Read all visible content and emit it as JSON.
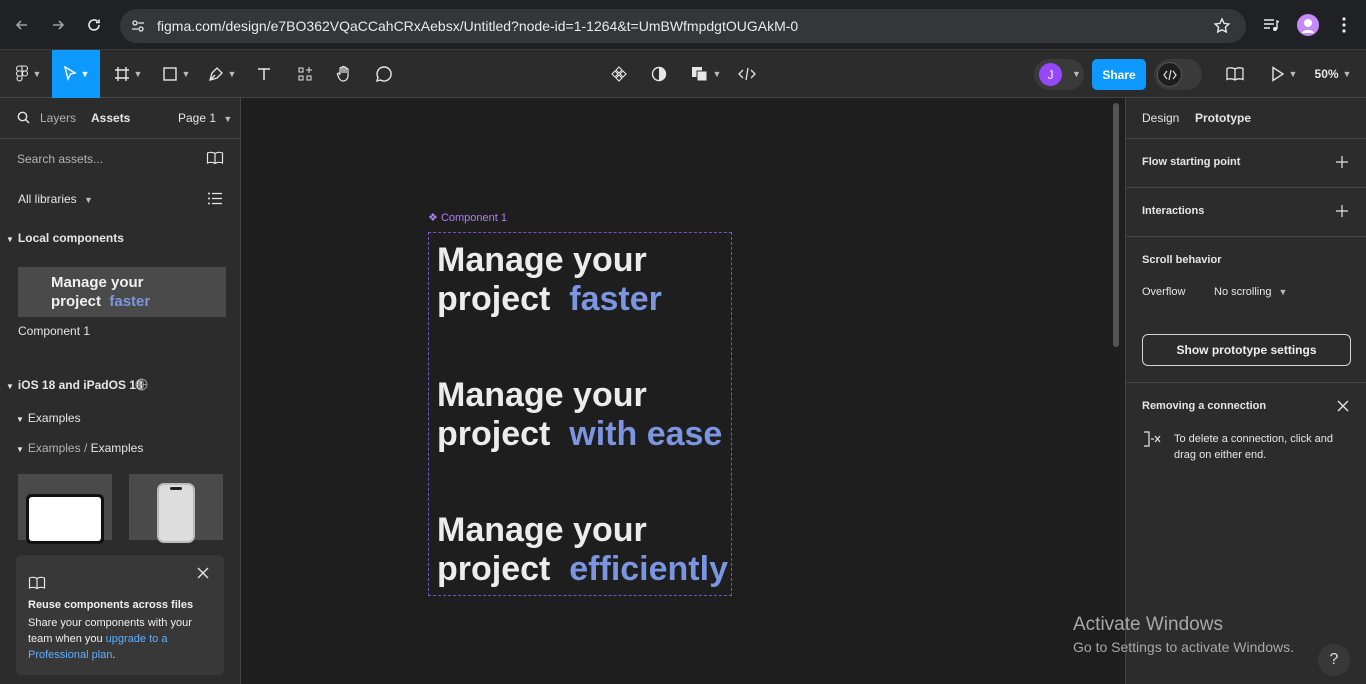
{
  "browser": {
    "url": "figma.com/design/e7BO362VQaCCahCRxAebsx/Untitled?node-id=1-1264&t=UmBWfmpdgtOUGAkM-0"
  },
  "toolbar": {
    "share_label": "Share",
    "zoom": "50%",
    "user_initial": "J",
    "accent_color": "#0d99ff"
  },
  "left_panel": {
    "tabs": [
      "Layers",
      "Assets"
    ],
    "active_tab": "Assets",
    "page_label": "Page 1",
    "search_placeholder": "Search assets...",
    "library_filter": "All libraries",
    "local_components_title": "Local components",
    "local_component": {
      "name": "Component 1",
      "thumb_line1": "Manage your",
      "thumb_line2": "project",
      "thumb_highlight": "faster"
    },
    "library": {
      "title": "iOS 18 and iPadOS 18",
      "group": "Examples",
      "subgroup_parent": "Examples /",
      "subgroup": "Examples"
    },
    "promo": {
      "title": "Reuse components across files",
      "body": "Share your components with your team when you",
      "link": "upgrade to a Professional plan",
      "end": "."
    }
  },
  "canvas": {
    "component_label": "Component 1",
    "variants": [
      {
        "line1": "Manage your",
        "line2": "project",
        "highlight": "faster"
      },
      {
        "line1": "Manage your",
        "line2": "project",
        "highlight": "with ease"
      },
      {
        "line1": "Manage your",
        "line2": "project",
        "highlight": "efficiently"
      }
    ]
  },
  "right_panel": {
    "tabs": [
      "Design",
      "Prototype"
    ],
    "active_tab": "Prototype",
    "flow_starting_point": "Flow starting point",
    "interactions": "Interactions",
    "scroll_behavior": "Scroll behavior",
    "overflow_label": "Overflow",
    "overflow_value": "No scrolling",
    "prototype_settings_button": "Show prototype settings",
    "tip_title": "Removing a connection",
    "tip_body": "To delete a connection, click and drag on either end."
  },
  "watermark": {
    "title": "Activate Windows",
    "subtitle": "Go to Settings to activate Windows."
  },
  "help_label": "?"
}
